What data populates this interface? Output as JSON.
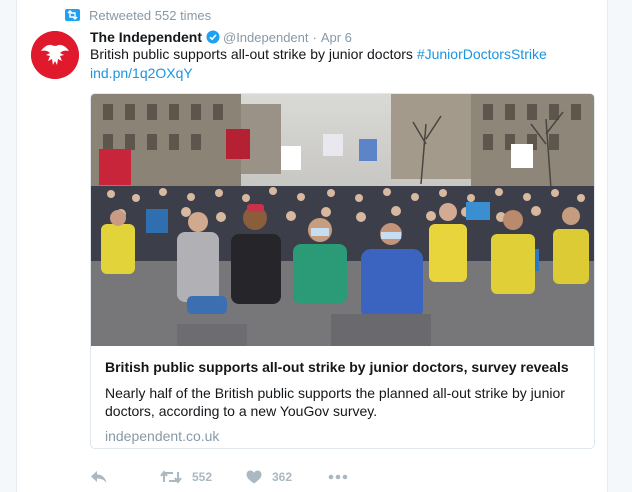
{
  "retweet_line": {
    "text": "Retweeted 552 times",
    "icon": "retweet-icon"
  },
  "author": {
    "name": "The Independent",
    "handle": "@Independent",
    "date": "Apr 6",
    "avatar": "eagle-logo",
    "verified_icon": "verified-badge-icon"
  },
  "tweet": {
    "text": "British public supports all-out strike by junior doctors",
    "hashtag": "#JuniorDoctorsStrike",
    "link": "ind.pn/1q2OXqY"
  },
  "card": {
    "image": "protest-photo",
    "title": "British public supports all-out strike by junior doctors, survey reveals",
    "description": "Nearly half of the British public supports the planned all-out strike by junior doctors, according to a new YouGov survey.",
    "domain": "independent.co.uk"
  },
  "actions": {
    "reply_icon": "reply-icon",
    "retweet_icon": "retweet-icon",
    "retweet_count": "552",
    "like_icon": "heart-icon",
    "like_count": "362",
    "more_icon": "more-icon"
  },
  "colors": {
    "link": "#1b95e0",
    "muted": "#8899a6",
    "action_grey": "#aab8c2",
    "avatar_red": "#e0192d",
    "verified_blue": "#1da1f2"
  }
}
